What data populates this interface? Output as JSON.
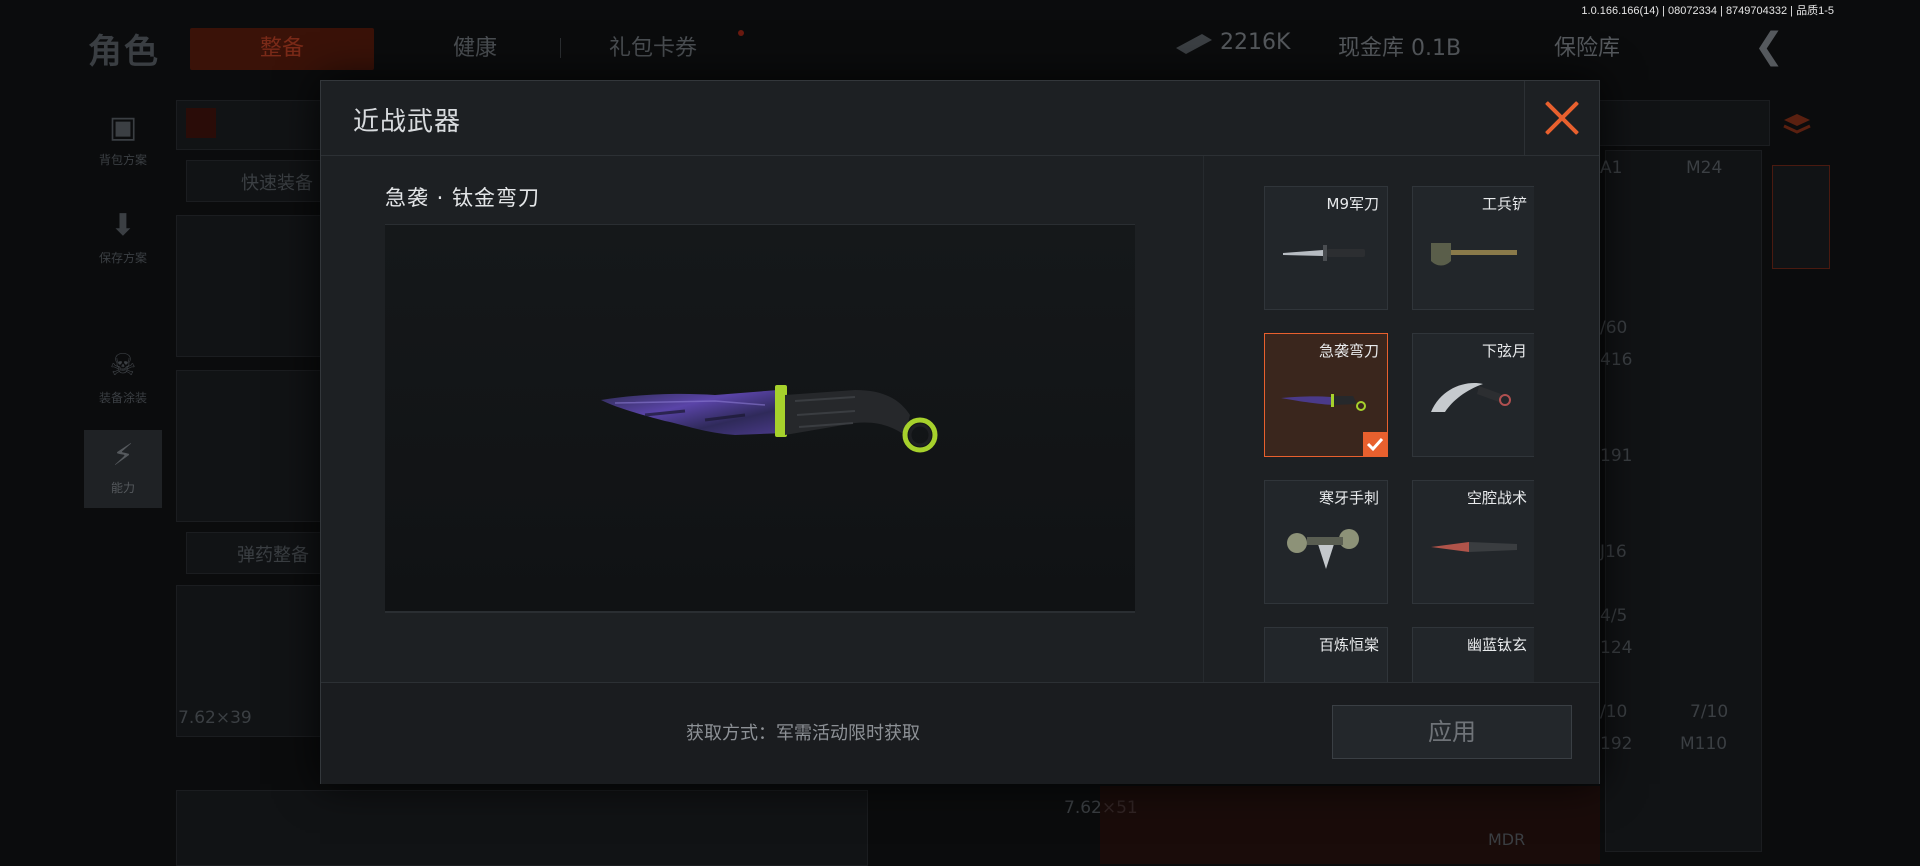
{
  "version_text": "1.0.166.166(14) | 08072334 | 8749704332 | 品质1-5",
  "background": {
    "title": "角色",
    "tabs": [
      "整备",
      "健康",
      "礼包卡券"
    ],
    "money": "2216K",
    "cash_vault": "现金库 0.1B",
    "insurance": "保险库",
    "side": [
      "背包方案",
      "保存方案",
      "装备涂装",
      "能力"
    ],
    "quick_equip": "快速装备",
    "ammo_prep": "弹药整备",
    "caliber_left": "7.62×39",
    "caliber_mid": "7.62×51",
    "right_labels": [
      "A1",
      "M24",
      "/60",
      "416",
      "191",
      "J16",
      "4/5",
      "124",
      "/10",
      "7/10",
      "192",
      "M110",
      "MDR"
    ]
  },
  "modal": {
    "title": "近战武器",
    "selected_weapon_name": "急袭 · 钛金弯刀",
    "source_text": "获取方式：军需活动限时获取",
    "apply_label": "应用",
    "items": [
      {
        "name": "M9军刀",
        "selected": false
      },
      {
        "name": "工兵铲",
        "selected": false
      },
      {
        "name": "急袭弯刀",
        "selected": true
      },
      {
        "name": "下弦月",
        "selected": false
      },
      {
        "name": "寒牙手刺",
        "selected": false
      },
      {
        "name": "空腔战术",
        "selected": false
      },
      {
        "name": "百炼恒棠",
        "selected": false
      },
      {
        "name": "幽蓝钛玄",
        "selected": false
      }
    ]
  },
  "colors": {
    "accent": "#e8602e",
    "modal_bg": "#1d2023",
    "knife_purple": "#4a3a8a",
    "knife_green": "#a6d12c"
  }
}
